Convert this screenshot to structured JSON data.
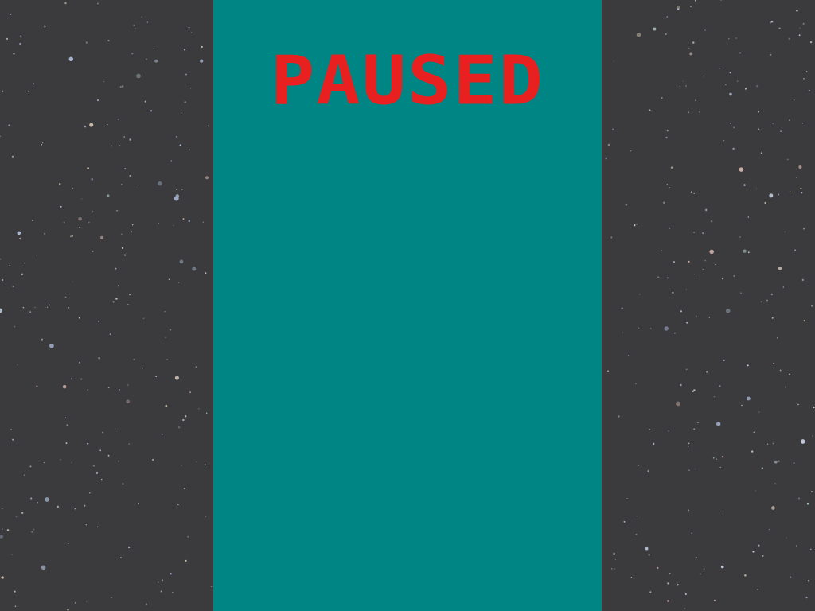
{
  "game": {
    "status_text": "PAUSED"
  },
  "colors": {
    "background": "#3b3b3d",
    "playfield": "#008585",
    "status_text": "#e8201f",
    "playfield_border": "#1e1e1e"
  }
}
